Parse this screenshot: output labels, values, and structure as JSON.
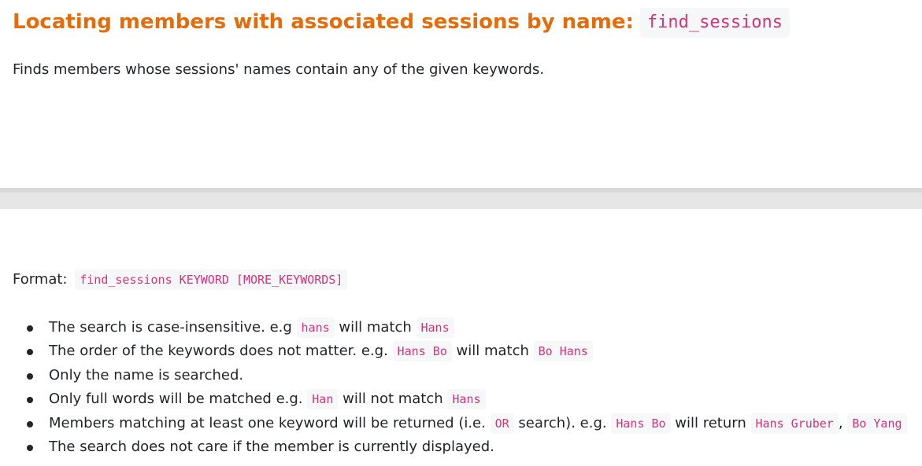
{
  "heading": {
    "text": "Locating members with associated sessions by name:",
    "command": "find_sessions"
  },
  "description": "Finds members whose sessions' names contain any of the given keywords.",
  "format": {
    "label": "Format:",
    "code": "find_sessions KEYWORD [MORE_KEYWORDS]"
  },
  "bullets": {
    "b1": {
      "text1": "The search is case-insensitive. e.g",
      "code1": "hans",
      "text2": "will match",
      "code2": "Hans"
    },
    "b2": {
      "text1": "The order of the keywords does not matter. e.g.",
      "code1": "Hans Bo",
      "text2": "will match",
      "code2": "Bo Hans"
    },
    "b3": {
      "text1": "Only the name is searched."
    },
    "b4": {
      "text1": "Only full words will be matched e.g.",
      "code1": "Han",
      "text2": "will not match",
      "code2": "Hans"
    },
    "b5": {
      "text1": "Members matching at least one keyword will be returned (i.e.",
      "code1": "OR",
      "text2": "search). e.g.",
      "code2": "Hans Bo",
      "text3": "will return",
      "code3": "Hans Gruber",
      "sep": ",",
      "code4": "Bo Yang"
    },
    "b6": {
      "text1": "The search does not care if the member is currently displayed."
    }
  }
}
